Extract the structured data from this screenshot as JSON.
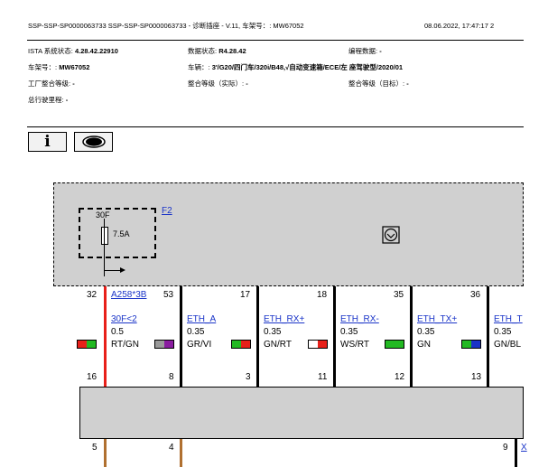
{
  "header": {
    "doc_line": "SSP-SSP-SP0000063733 SSP-SSP-SP0000063733 - 诊断插座 - V.11, 车架号：: MW67052",
    "datetime": "08.06.2022, 17:47:17 2",
    "ista_label": "ISTA 系统状态:",
    "ista_value": "4.28.42.22910",
    "data_status_label": "数据状态:",
    "data_status_value": "R4.28.42",
    "program_label": "编程数据:",
    "program_value": "-",
    "frame_label": "车架号：:",
    "frame_value": "MW67052",
    "vehicle_label": "车辆：:",
    "vehicle_value": "3'/G20/四门车/320i/B48,√自动变速箱/ECE/左 座驾驶型/2020/01",
    "factory_label": "工厂整合等级:",
    "factory_value": "-",
    "integ_actual_label": "整合等级（实际）:",
    "integ_actual_value": "-",
    "integ_target_label": "整合等级（目标）:",
    "integ_target_value": "-",
    "mileage_label": "总行驶里程:",
    "mileage_value": "-"
  },
  "toolbar": {
    "info_label": "i",
    "view_icon": "eye-icon"
  },
  "diagram": {
    "fuse_label": "F2",
    "fuse_top": "30F",
    "fuse_rating": "7.5A",
    "ground_icon": "ground-symbol-icon",
    "top_pins": [
      {
        "pin": "32",
        "label": "A258*3B"
      },
      {
        "pin": "53"
      },
      {
        "pin": "17"
      },
      {
        "pin": "18"
      },
      {
        "pin": "35"
      },
      {
        "pin": "36"
      }
    ],
    "signals": [
      {
        "name": "30F<2",
        "size": "0.5",
        "color": "RT/GN",
        "c1": "#e8201a",
        "c2": "#22b922"
      },
      {
        "name": "",
        "size": "",
        "color": "GR/VI",
        "c1": "#9a9a9a",
        "c2": "#8a1ca0"
      },
      {
        "name": "ETH_A",
        "size": "0.35",
        "color": "GN/RT",
        "c1": "#22b922",
        "c2": "#e8201a"
      },
      {
        "name": "ETH_RX+",
        "size": "0.35",
        "color": "WS/RT",
        "c1": "#ffffff",
        "c2": "#e8201a"
      },
      {
        "name": "ETH_RX-",
        "size": "0.35",
        "color": "GN",
        "c1": "#22b922",
        "c2": "#22b922"
      },
      {
        "name": "ETH_TX+",
        "size": "0.35",
        "color": "GN/BL",
        "c1": "#22b922",
        "c2": "#1a34c8"
      },
      {
        "name": "ETH_TX-",
        "size": "0.35",
        "color": "GN/BL",
        "c1": "#22b922",
        "c2": "#1a34c8"
      }
    ],
    "display_names": [
      "30F<2",
      "ETH_A",
      "ETH_RX+",
      "ETH_RX-",
      "ETH_TX+",
      "ETH_T"
    ],
    "bottom_pins_top": [
      "16",
      "8",
      "3",
      "11",
      "12",
      "13"
    ],
    "bottom_pins_lower": [
      "5",
      "4",
      "9"
    ],
    "lower_right_label": "X"
  }
}
